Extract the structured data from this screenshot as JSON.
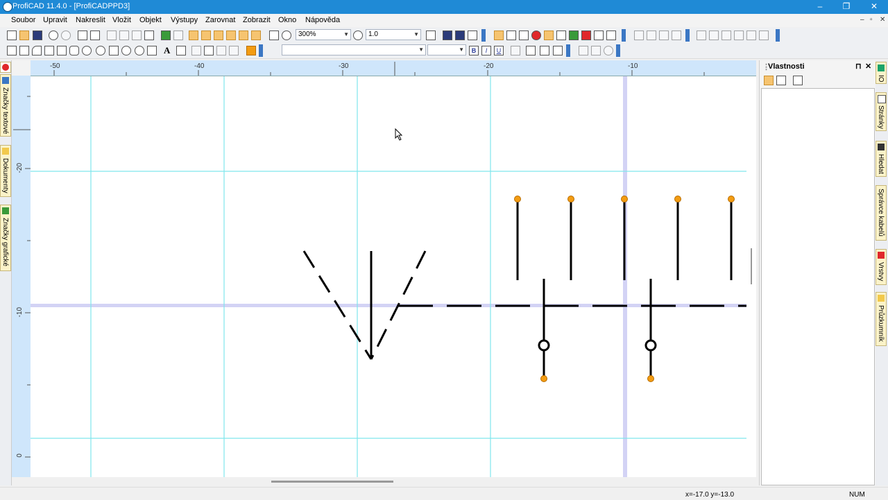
{
  "window": {
    "title": "ProfiCAD 11.4.0 - [ProfiCADPPD3]",
    "minimize": "–",
    "restore": "❐",
    "close": "✕"
  },
  "menu": [
    "Soubor",
    "Upravit",
    "Nakreslit",
    "Vložit",
    "Objekt",
    "Výstupy",
    "Zarovnat",
    "Zobrazit",
    "Okno",
    "Nápověda"
  ],
  "mdi_controls": [
    "–",
    "▫",
    "✕"
  ],
  "toolbar": {
    "zoom_value": "300%",
    "line_width_value": "1.0",
    "font_combo_value": "",
    "font_size_value": "",
    "bold": "B",
    "italic": "I",
    "underline": "U",
    "text_tool": "A"
  },
  "left_tabs": [
    "Značky textové",
    "Dokumenty",
    "Značky grafické"
  ],
  "ruler_h_labels": [
    "-50",
    "-40",
    "-30",
    "-20",
    "-10"
  ],
  "ruler_v_labels": [
    "-20",
    "-10",
    "0"
  ],
  "properties_panel": {
    "title": "Vlastnosti",
    "pin": "⊓",
    "close": "✕"
  },
  "right_tabs": [
    "IO",
    "Stránky",
    "Hledat",
    "Správce kabelů",
    "Vrstvy",
    "Průzkumník"
  ],
  "status": {
    "coords": "x=-17.0  y=-13.0",
    "num": "NUM"
  },
  "colors": {
    "titlebar": "#1f8ad6",
    "grid": "#7fe7ec",
    "highlight_axis": "#d3d3f5",
    "terminal": "#f39c12",
    "ruler": "#cfe6fb"
  }
}
